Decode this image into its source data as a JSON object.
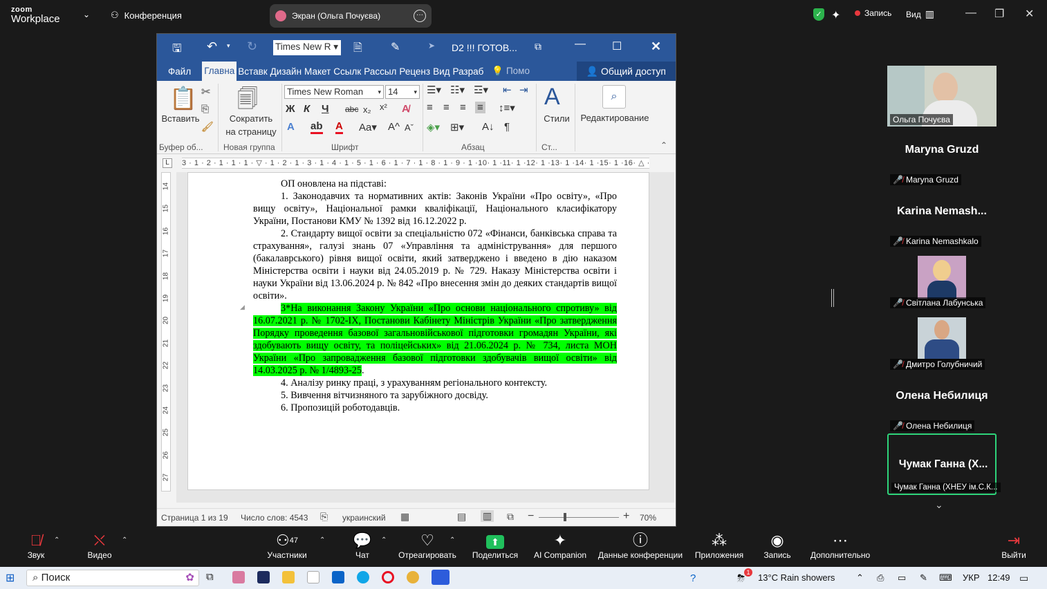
{
  "zoom": {
    "logo_line1": "zoom",
    "logo_line2": "Workplace",
    "meeting": "Конференция",
    "share_label": "Экран (Ольга Почуєва)",
    "record": "Запись",
    "view": "Вид"
  },
  "word": {
    "font_box": "Times New R",
    "title": "D2 !!! ГОТОВ...",
    "tabs": [
      "Файл",
      "Главна",
      "Вставк",
      "Дизайн",
      "Макет",
      "Ссылк",
      "Рассыл",
      "Реценз",
      "Вид",
      "Разраб"
    ],
    "help": "Помо",
    "share": "Общий доступ",
    "ribbon": {
      "paste": "Вставить",
      "shrink1": "Сократить",
      "shrink2": "на страницу",
      "font": "Times New Roman",
      "size": "14",
      "styles": "Стили",
      "editing": "Редактирование",
      "g_clipboard": "Буфер об...",
      "g_new": "Новая группа",
      "g_font": "Шрифт",
      "g_para": "Абзац",
      "g_styles": "Ст..."
    },
    "ruler_text": "3 · 1 · 2 · 1 · 1 · 1 · ▽ · 1 · 2 · 1 · 3 · 1 · 4 · 1 · 5 · 1 · 6 · 1 · 7 · 1 · 8 · 1 · 9 · 1 ·10· 1 ·11· 1 ·12· 1 ·13· 1 ·14· 1 ·15· 1 ·16· △ ·17·",
    "vruler": [
      "14",
      "15",
      "16",
      "17",
      "18",
      "19",
      "20",
      "21",
      "22",
      "23",
      "24",
      "25",
      "26",
      "27"
    ],
    "doc": {
      "p0": "ОП оновлена на підставі:",
      "p1": "1. Законодавчих та нормативних актів: Законів України «Про освіту», «Про вищу освіту», Національної рамки кваліфікації, Національного класифікатору України, Постанови КМУ № 1392 від 16.12.2022 р.",
      "p2": "2. Стандарту вищої освіти за спеціальністю 072 «Фінанси, банківська справа та страхування», галузі знань 07 «Управління та адміністрування» для першого (бакалаврського) рівня вищої освіти, який затверджено і введено в дію наказом Міністерства освіти і науки від 24.05.2019 р. № 729. Наказу Міністерства освіти і науки України від 13.06.2024 р. № 842 «Про внесення змін до деяких стандартів вищої освіти».",
      "p3": "3*На виконання Закону України «Про основи національного спротиву» від 16.07.2021 р. № 1702-IX, Постанови Кабінету Міністрів України «Про затвердження Порядку проведення базової загальновійськової підготовки громадян України, які здобувають вищу освіту, та поліцейських» від 21.06.2024 р. № 734, листа МОН України «Про запровадження базової підготовки здобувачів вищої освіти» від 14.03.2025 р. № 1/4893-25",
      "p3_end": ".",
      "p4": "4. Аналізу ринку праці, з урахуванням регіонального контексту.",
      "p5": "5. Вивчення вітчизняного та зарубіжного досвіду.",
      "p6": "6. Пропозицій роботодавців."
    },
    "status": {
      "page": "Страница 1 из 19",
      "words": "Число слов: 4543",
      "lang": "украинский",
      "zoom": "70%"
    }
  },
  "participants": [
    {
      "name": "Ольга Почуєва",
      "type": "video"
    },
    {
      "big": "Maryna Gruzd",
      "name": "Maryna Gruzd"
    },
    {
      "big": "Karina  Nemash...",
      "name": "Karina Nemashkalo"
    },
    {
      "name": "Світлана Лабунська",
      "type": "photo"
    },
    {
      "name": "Дмитро Голубничий",
      "type": "photo"
    },
    {
      "big": "Олена Небилиця",
      "name": "Олена Небилиця"
    },
    {
      "big": "Чумак Ганна  (Х...",
      "name": "Чумак Ганна (ХНЕУ ім.С.К..."
    }
  ],
  "toolbar": {
    "audio": "Звук",
    "video": "Видео",
    "participants": "Участники",
    "participants_count": "47",
    "chat": "Чат",
    "react": "Отреагировать",
    "share": "Поделиться",
    "ai": "AI Companion",
    "info": "Данные конференции",
    "apps": "Приложения",
    "record": "Запись",
    "more": "Дополнительно",
    "leave": "Выйти"
  },
  "taskbar": {
    "search": "Поиск",
    "weather": "13°C  Rain showers",
    "lang": "УКР",
    "time": "12:49",
    "badge": "1"
  },
  "colors": {
    "word_blue": "#2b579a",
    "highlight": "#00ff00",
    "zoom_green": "#0e71eb",
    "active_border": "#2ed47a"
  }
}
